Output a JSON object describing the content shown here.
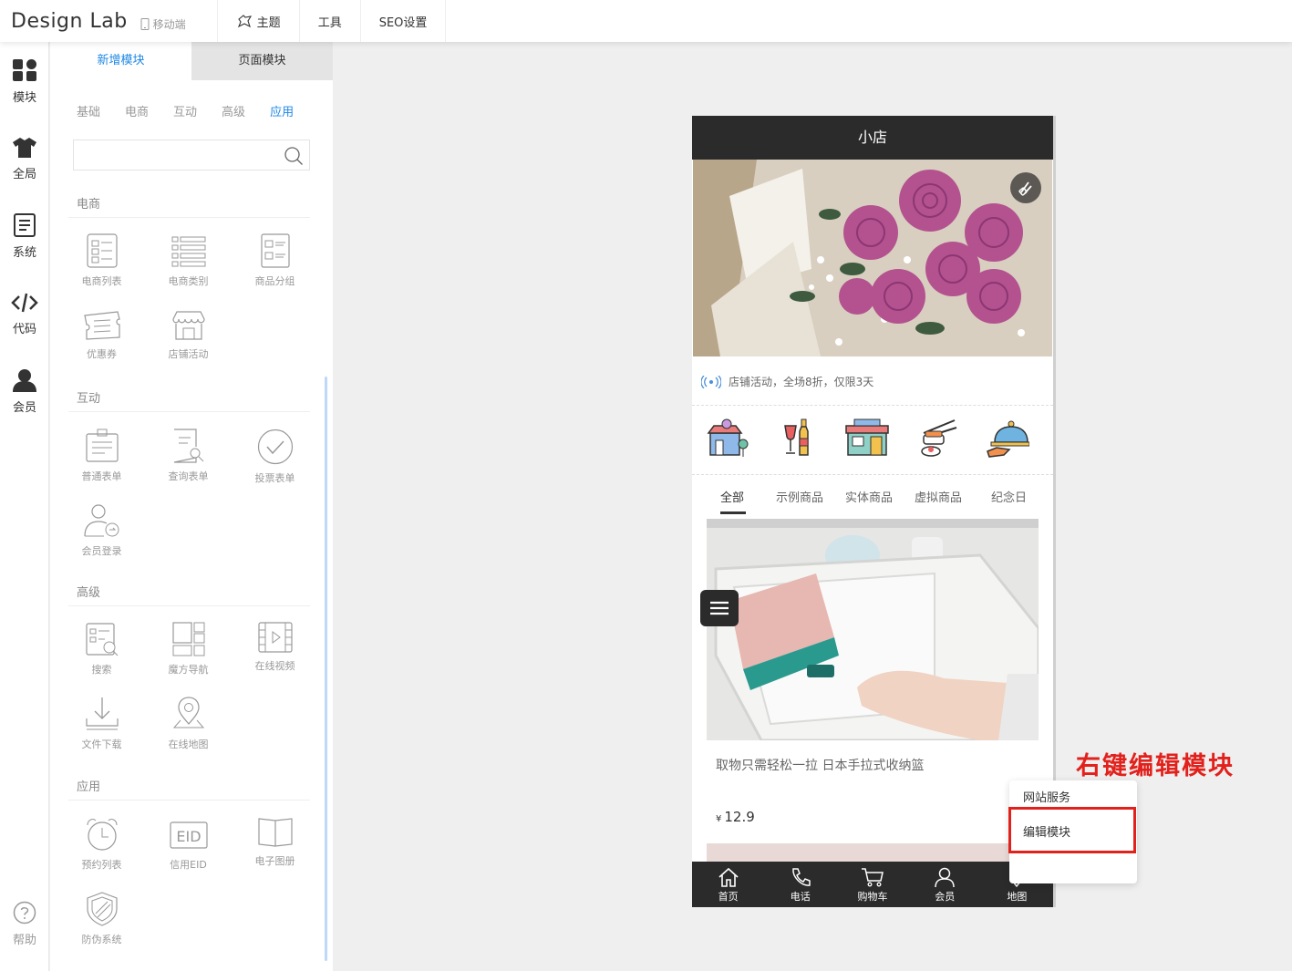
{
  "header": {
    "logo": "Design Lab",
    "mobile_label": "移动端",
    "menu": [
      {
        "label": "主题",
        "icon": "theme-icon"
      },
      {
        "label": "工具",
        "icon": ""
      },
      {
        "label": "SEO设置",
        "icon": ""
      }
    ]
  },
  "rail": {
    "items": [
      {
        "label": "模块",
        "icon": "grid-icon"
      },
      {
        "label": "全局",
        "icon": "shirt-icon"
      },
      {
        "label": "系统",
        "icon": "document-icon"
      },
      {
        "label": "代码",
        "icon": "code-icon"
      },
      {
        "label": "会员",
        "icon": "user-icon"
      }
    ],
    "help": "帮助"
  },
  "panel": {
    "tabs": [
      "新增模块",
      "页面模块"
    ],
    "subtabs": [
      "基础",
      "电商",
      "互动",
      "高级",
      "应用"
    ],
    "active_subtab": "应用",
    "search_placeholder": "",
    "sections": {
      "ecommerce": {
        "title": "电商",
        "items": [
          "电商列表",
          "电商类别",
          "商品分组",
          "优惠券",
          "店铺活动"
        ]
      },
      "interactive": {
        "title": "互动",
        "items": [
          "普通表单",
          "查询表单",
          "投票表单",
          "会员登录"
        ]
      },
      "advanced": {
        "title": "高级",
        "items": [
          "搜索",
          "魔方导航",
          "在线视频",
          "文件下载",
          "在线地图"
        ]
      },
      "apps": {
        "title": "应用",
        "items": [
          "预约列表",
          "信用EID",
          "电子图册",
          "防伪系统"
        ]
      }
    }
  },
  "phone": {
    "title": "小店",
    "notice": "店铺活动，全场8折，仅限3天",
    "product_tabs": [
      "全部",
      "示例商品",
      "实体商品",
      "虚拟商品",
      "纪念日"
    ],
    "product": {
      "title": "取物只需轻松一拉 日本手拉式收纳篮",
      "currency": "¥",
      "price": "12.9"
    },
    "bottom_nav": [
      "首页",
      "电话",
      "购物车",
      "会员",
      "地图"
    ]
  },
  "context_menu": {
    "items": [
      "网站服务",
      "编辑模块"
    ]
  },
  "annotation": "右键编辑模块",
  "colors": {
    "accent": "#1e88e5",
    "highlight": "#e2211c",
    "dark": "#2b2b2b"
  }
}
